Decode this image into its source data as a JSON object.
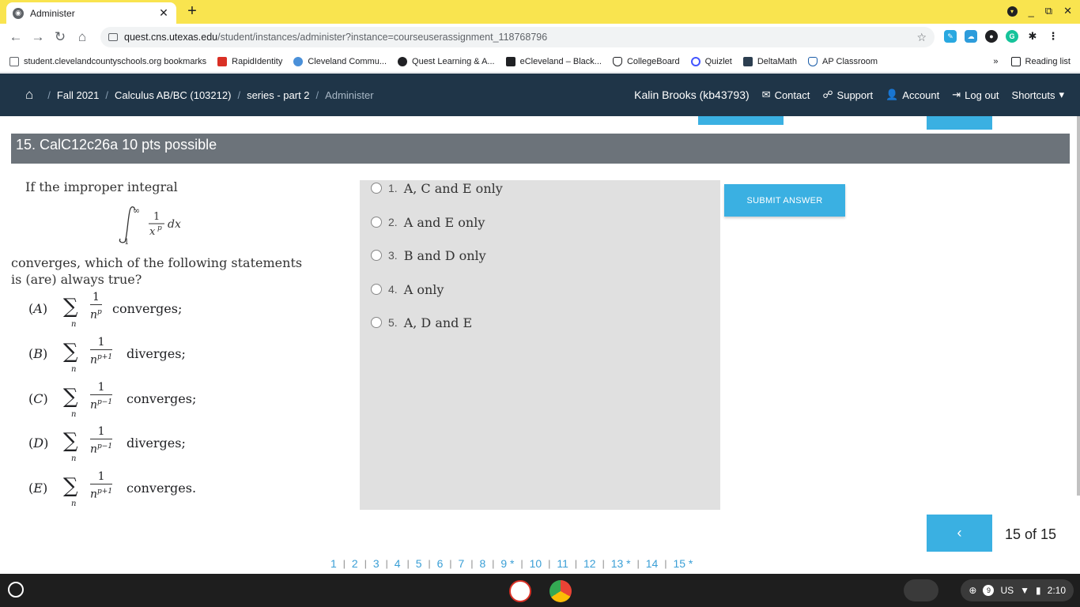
{
  "browser": {
    "tab_title": "Administer",
    "new_tab": "+",
    "url_host": "quest.cns.utexas.edu",
    "url_path": "/student/instances/administer?instance=courseuserassignment_118768796",
    "bookmarks": [
      {
        "label": "student.clevelandcountyschools.org bookmarks",
        "color": "#5f6368"
      },
      {
        "label": "RapidIdentity",
        "color": "#d93025"
      },
      {
        "label": "Cleveland Commu...",
        "color": "#4a90d9"
      },
      {
        "label": "Quest Learning & A...",
        "color": "#202124"
      },
      {
        "label": "eCleveland – Black...",
        "color": "#202124"
      },
      {
        "label": "CollegeBoard",
        "color": "#202124"
      },
      {
        "label": "Quizlet",
        "color": "#4255ff"
      },
      {
        "label": "DeltaMath",
        "color": "#2c3e50"
      },
      {
        "label": "AP Classroom",
        "color": "#1a5ca8"
      }
    ],
    "bookmarks_more": "»",
    "reading_list": "Reading list"
  },
  "header": {
    "crumbs": [
      "Fall 2021",
      "Calculus AB/BC (103212)",
      "series - part 2",
      "Administer"
    ],
    "user": "Kalin Brooks (kb43793)",
    "contact": "Contact",
    "support": "Support",
    "account": "Account",
    "logout": "Log out",
    "shortcuts": "Shortcuts"
  },
  "question": {
    "title": "15. CalC12c26a 10 pts possible",
    "intro": "If the improper integral",
    "converges_text": "converges, which of the following statements is (are) always true?",
    "statements": [
      {
        "label": "A",
        "exp": "p",
        "word": "converges;"
      },
      {
        "label": "B",
        "exp": "p+1",
        "word": "diverges;"
      },
      {
        "label": "C",
        "exp": "p−1",
        "word": "converges;"
      },
      {
        "label": "D",
        "exp": "p−1",
        "word": "diverges;"
      },
      {
        "label": "E",
        "exp": "p+1",
        "word": "converges."
      }
    ]
  },
  "answers": [
    {
      "num": "1.",
      "text": "A, C and E only"
    },
    {
      "num": "2.",
      "text": "A and E only"
    },
    {
      "num": "3.",
      "text": "B and D only"
    },
    {
      "num": "4.",
      "text": "A only"
    },
    {
      "num": "5.",
      "text": "A, D and E"
    }
  ],
  "submit_label": "SUBMIT ANSWER",
  "prev_label": "‹",
  "counter": "15 of 15",
  "pages": [
    "1",
    "2",
    "3",
    "4",
    "5",
    "6",
    "7",
    "8",
    "9 *",
    "10",
    "11",
    "12",
    "13 *",
    "14",
    "15 *"
  ],
  "tray": {
    "region": "US",
    "time": "2:10",
    "notifications": "9"
  },
  "colors": {
    "header_bg": "#1f3548",
    "accent": "#3ab0e2",
    "question_bar": "#6c737a",
    "tabstrip": "#f9e44f"
  }
}
